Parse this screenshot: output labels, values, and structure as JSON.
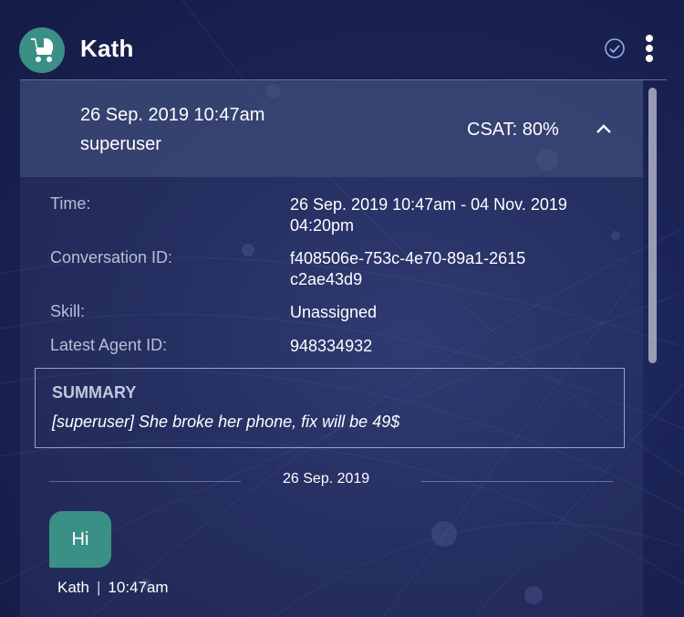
{
  "header": {
    "contact_name": "Kath",
    "avatar_icon": "baby-stroller-icon",
    "status_icon": "check-circle-icon",
    "menu_icon": "more-vertical-icon"
  },
  "conversation": {
    "date": "26 Sep. 2019 10:47am",
    "user": "superuser",
    "csat": "CSAT: 80%",
    "toggle_icon": "chevron-up-icon"
  },
  "details": [
    {
      "label": "Time:",
      "value": "26 Sep. 2019 10:47am - 04 Nov. 2019 04:20pm"
    },
    {
      "label": "Conversation ID:",
      "value": "f408506e-753c-4e70-89a1-2615c2ae43d9"
    },
    {
      "label": "Skill:",
      "value": "Unassigned"
    },
    {
      "label": "Latest Agent ID:",
      "value": "948334932"
    }
  ],
  "summary": {
    "title": "SUMMARY",
    "text": "[superuser] She broke her phone, fix will be 49$"
  },
  "transcript": {
    "date_divider": "26 Sep. 2019",
    "messages": [
      {
        "text": "Hi",
        "author": "Kath",
        "time": "10:47am"
      }
    ]
  },
  "colors": {
    "accent_teal": "#3a8f86",
    "background": "#1c2558"
  }
}
